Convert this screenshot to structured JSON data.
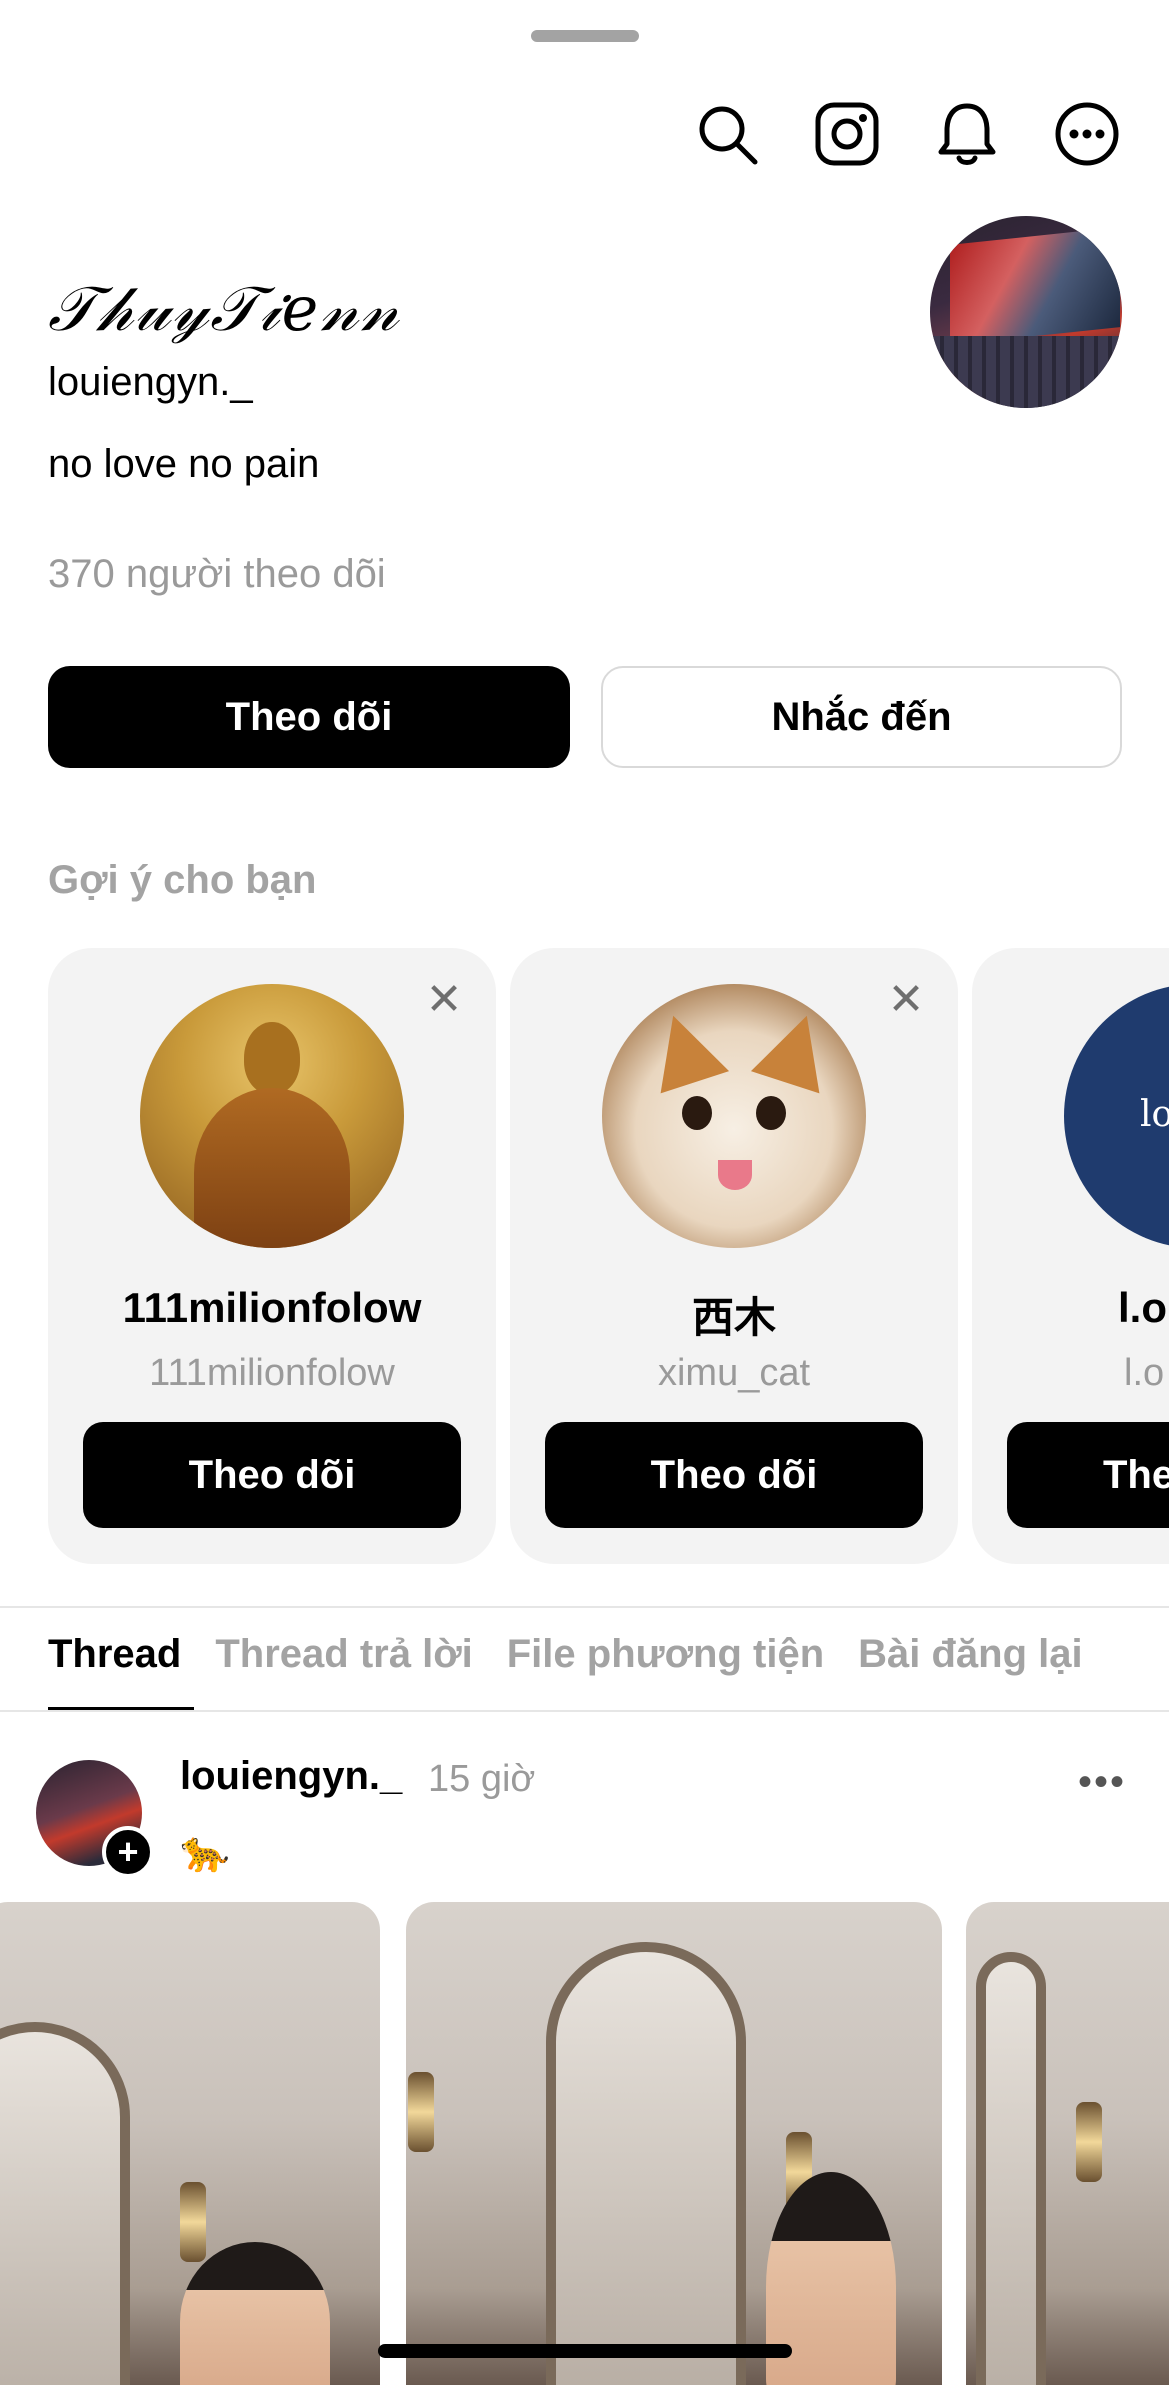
{
  "header": {
    "icons": [
      "search-icon",
      "instagram-icon",
      "bell-icon",
      "more-options-icon"
    ]
  },
  "profile": {
    "display_name": "𝒯𝒽𝓊𝓎𝒯𝒾𝑒𝓃𝓃",
    "handle": "louiengyn._",
    "bio": "no love no pain",
    "followers": "370 người theo dõi"
  },
  "actions": {
    "follow_label": "Theo dõi",
    "mention_label": "Nhắc đến"
  },
  "suggestions": {
    "title": "Gợi ý cho bạn",
    "close_symbol": "✕",
    "items": [
      {
        "name": "111milionfolow",
        "handle": "111milionfolow",
        "button": "Theo dõi"
      },
      {
        "name": "西木",
        "handle": "ximu_cat",
        "button": "Theo dõi"
      },
      {
        "name": "l.o",
        "handle": "l.o",
        "button": "The",
        "avatar_text": "lo"
      }
    ]
  },
  "tabs": [
    {
      "label": "Thread",
      "active": true
    },
    {
      "label": "Thread trả lời",
      "active": false
    },
    {
      "label": "File phương tiện",
      "active": false
    },
    {
      "label": "Bài đăng lại",
      "active": false
    }
  ],
  "post": {
    "username": "louiengyn._",
    "time": "15 giờ",
    "more_symbol": "•••",
    "emoji": "🐆",
    "plus_symbol": "+"
  },
  "colors": {
    "primary": "#000000",
    "muted_text": "#9a9a9a",
    "card_bg": "#f3f3f3"
  }
}
